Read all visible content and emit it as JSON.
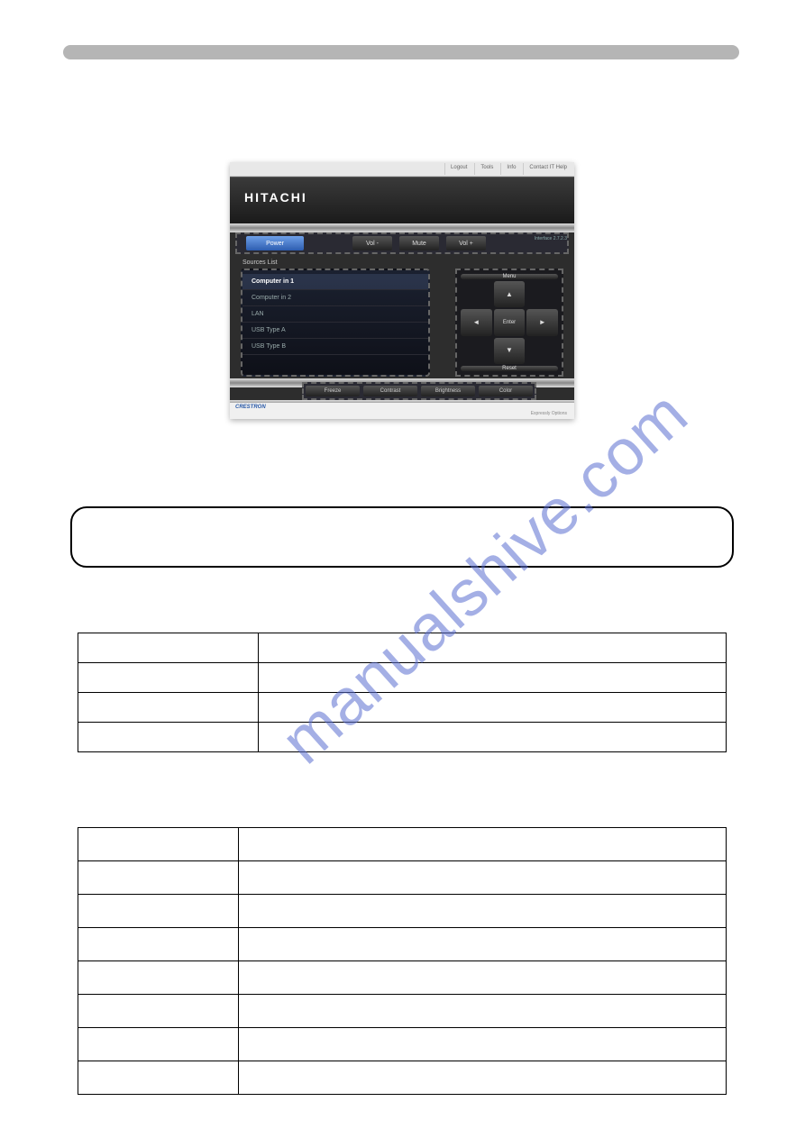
{
  "header_bar": "",
  "device": {
    "topbar": {
      "logout": "Logout",
      "tools": "Tools",
      "info": "Info",
      "help": "Contact IT Help"
    },
    "brand": "HITACHI",
    "interface_version": "Interface 2.7.2.3",
    "toolbar": {
      "power": "Power",
      "vol_minus": "Vol -",
      "mute": "Mute",
      "vol_plus": "Vol +"
    },
    "sources_label": "Sources List",
    "sources": {
      "items": [
        {
          "label": "Computer in 1",
          "selected": true
        },
        {
          "label": "Computer in 2",
          "selected": false
        },
        {
          "label": "LAN",
          "selected": false
        },
        {
          "label": "USB Type A",
          "selected": false
        },
        {
          "label": "USB Type B",
          "selected": false
        }
      ]
    },
    "nav": {
      "menu": "Menu",
      "up": "▲",
      "left": "◄",
      "enter": "Enter",
      "right": "►",
      "down": "▼",
      "reset": "Reset"
    },
    "bottom": {
      "freeze": "Freeze",
      "contrast": "Contrast",
      "brightness": "Brightness",
      "color": "Color"
    },
    "crestron_logo": "CRESTRON",
    "crestron_tag": "Expressly Options"
  },
  "watermark": "manualshive.com"
}
